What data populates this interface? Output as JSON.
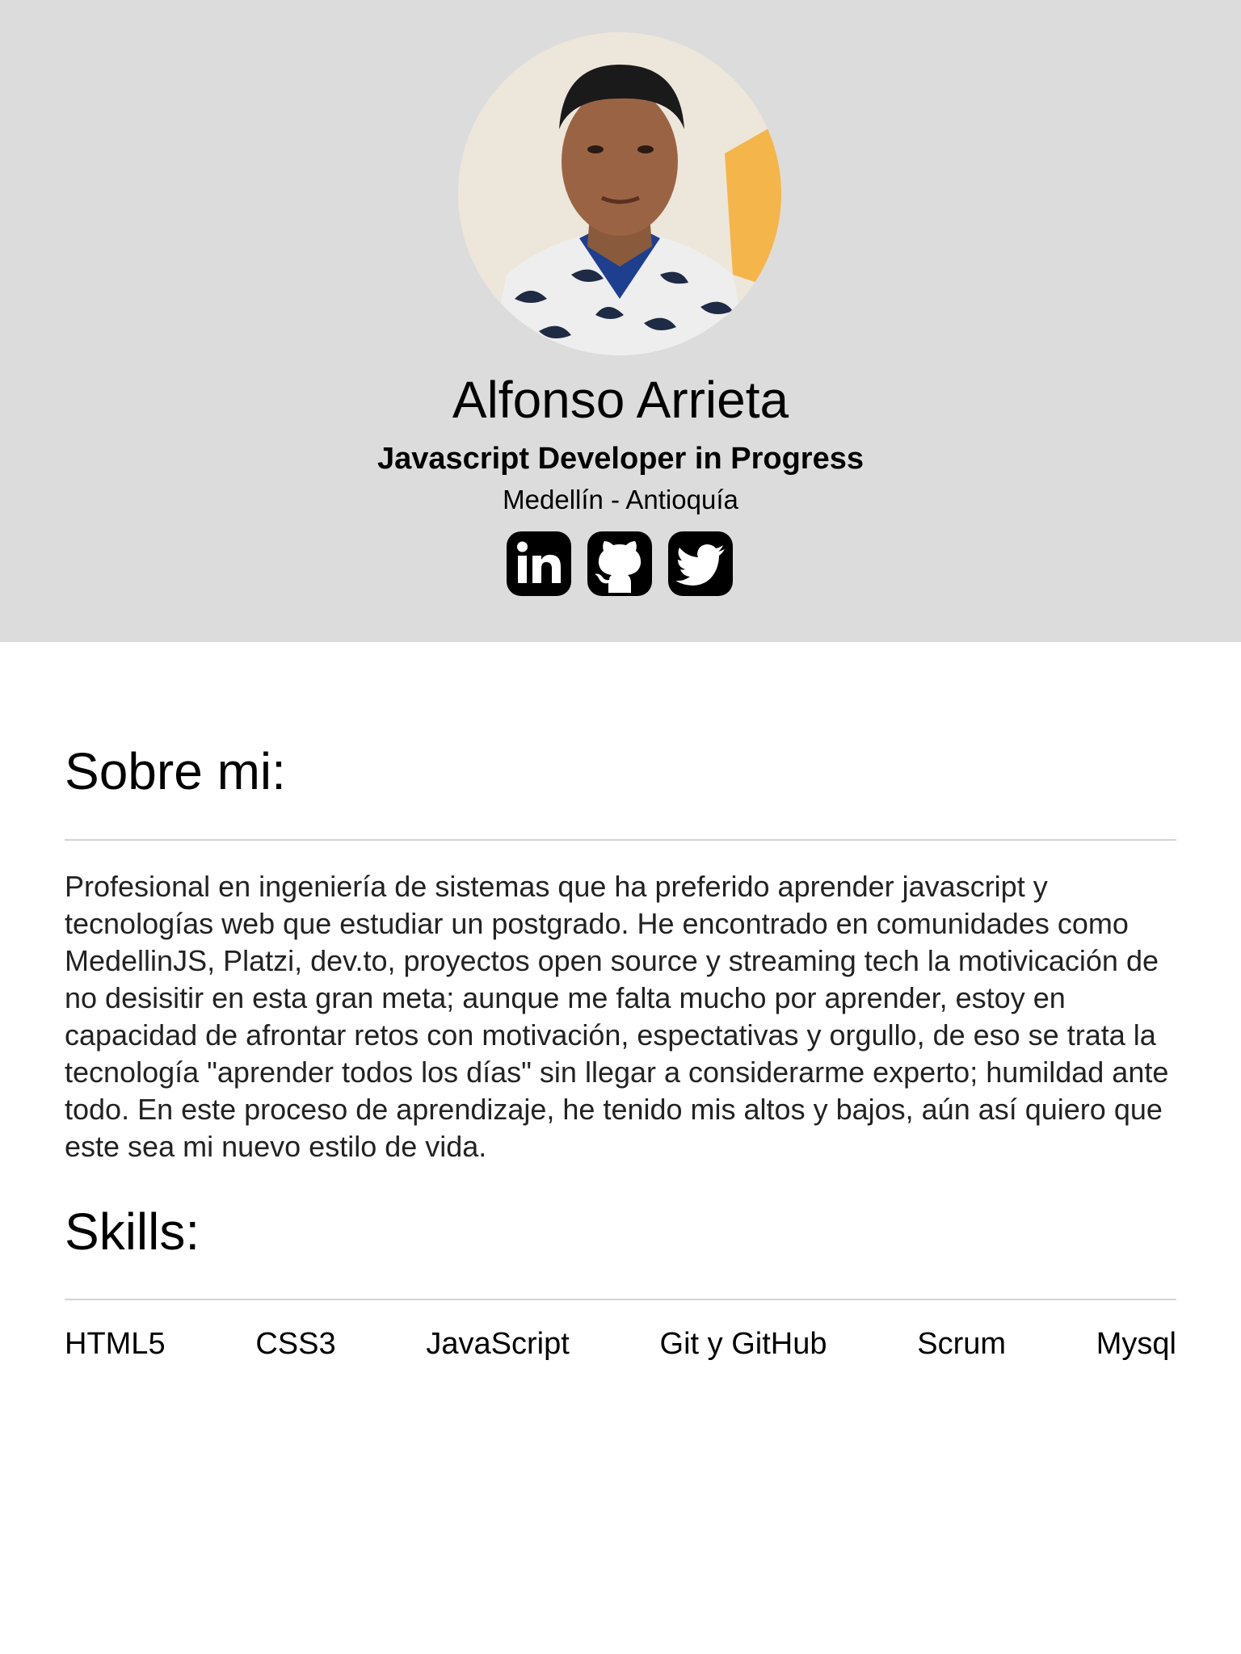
{
  "profile": {
    "name": "Alfonso Arrieta",
    "role": "Javascript Developer in Progress",
    "location": "Medellín - Antioquía"
  },
  "social": [
    {
      "label": "LinkedIn",
      "icon": "linkedin-icon"
    },
    {
      "label": "GitHub",
      "icon": "github-icon"
    },
    {
      "label": "Twitter",
      "icon": "twitter-icon"
    }
  ],
  "about": {
    "title": "Sobre mi:",
    "text": "Profesional en ingeniería de sistemas que ha preferido aprender javascript y tecnologías web que estudiar un postgrado. He encontrado en comunidades como MedellinJS, Platzi, dev.to, proyectos open source y streaming tech la motivicación de no desisitir en esta gran meta; aunque me falta mucho por aprender, estoy en capacidad de afrontar retos con motivación, espectativas y orgullo, de eso se trata la tecnología \"aprender todos los días\" sin llegar a considerarme experto; humildad ante todo. En este proceso de aprendizaje, he tenido mis altos y bajos, aún así quiero que este sea mi nuevo estilo de vida."
  },
  "skills": {
    "title": "Skills:",
    "items": [
      "HTML5",
      "CSS3",
      "JavaScript",
      "Git y GitHub",
      "Scrum",
      "Mysql"
    ]
  },
  "colors": {
    "header_bg": "#dcdcdc",
    "icon_bg": "#000000",
    "divider": "#d4d4d4"
  }
}
